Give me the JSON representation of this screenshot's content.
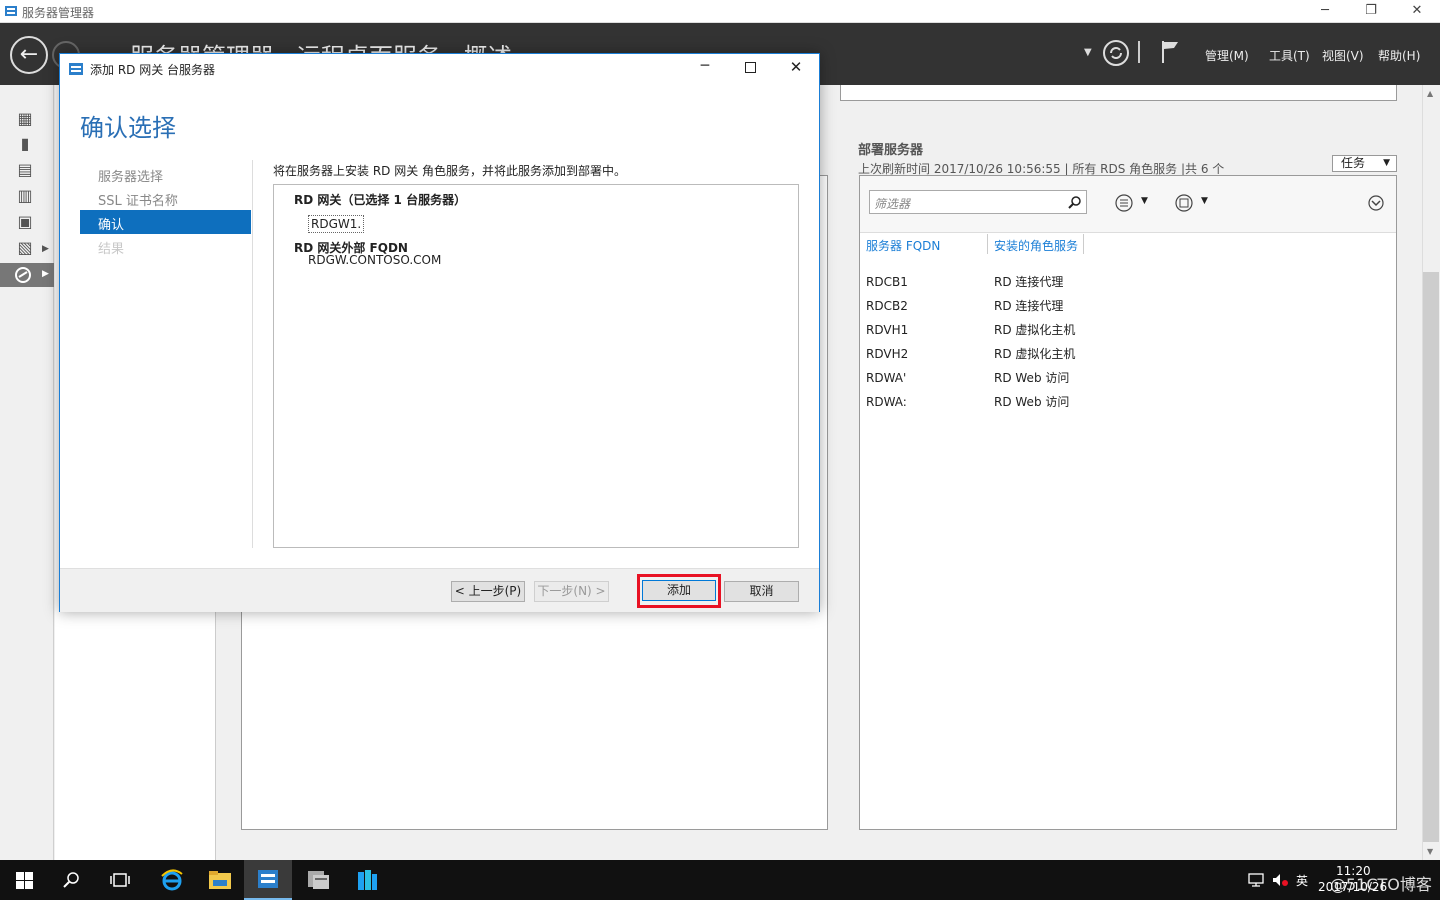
{
  "window": {
    "title": "服务器管理器",
    "minimize_glyph": "─",
    "restore_glyph": "❐",
    "close_glyph": "✕"
  },
  "header": {
    "breadcrumb": "服务器管理器 · 远程桌面服务 · 概述",
    "menus": [
      "管理(M)",
      "工具(T)",
      "视图(V)",
      "帮助(H)"
    ]
  },
  "dialog": {
    "title": "添加 RD 网关 台服务器",
    "heading": "确认选择",
    "nav": [
      "服务器选择",
      "SSL 证书名称",
      "确认",
      "结果"
    ],
    "description": "将在服务器上安装 RD 网关 角色服务，并将此服务添加到部署中。",
    "summary": {
      "group1_title": "RD 网关（已选择 1 台服务器）",
      "group1_item": "RDGW1.",
      "group2_title": "RD 网关外部 FQDN",
      "group2_item": "RDGW.CONTOSO.COM"
    },
    "buttons": {
      "prev": "< 上一步(P)",
      "next": "下一步(N) >",
      "add": "添加",
      "cancel": "取消"
    }
  },
  "servers_panel": {
    "title": "部署服务器",
    "subtitle": "上次刷新时间 2017/10/26 10:56:55 | 所有 RDS 角色服务 |共 6 个",
    "tasks_label": "任务",
    "filter_placeholder": "筛选器",
    "columns": [
      "服务器 FQDN",
      "安装的角色服务"
    ],
    "rows": [
      {
        "fqdn": "RDCB1",
        "role": "RD 连接代理"
      },
      {
        "fqdn": "RDCB2",
        "role": "RD 连接代理"
      },
      {
        "fqdn": "RDVH1",
        "role": "RD 虚拟化主机"
      },
      {
        "fqdn": "RDVH2",
        "role": "RD 虚拟化主机"
      },
      {
        "fqdn": "RDWA'",
        "role": "RD Web 访问"
      },
      {
        "fqdn": "RDWA:",
        "role": "RD Web 访问"
      }
    ]
  },
  "taskbar": {
    "ime": "英",
    "time": "11:20",
    "date": "2017/10/26",
    "watermark": "@51CTO博客"
  },
  "colors": {
    "accent": "#1a7ed6",
    "heading": "#2a6fb5",
    "highlight": "#e81123"
  }
}
